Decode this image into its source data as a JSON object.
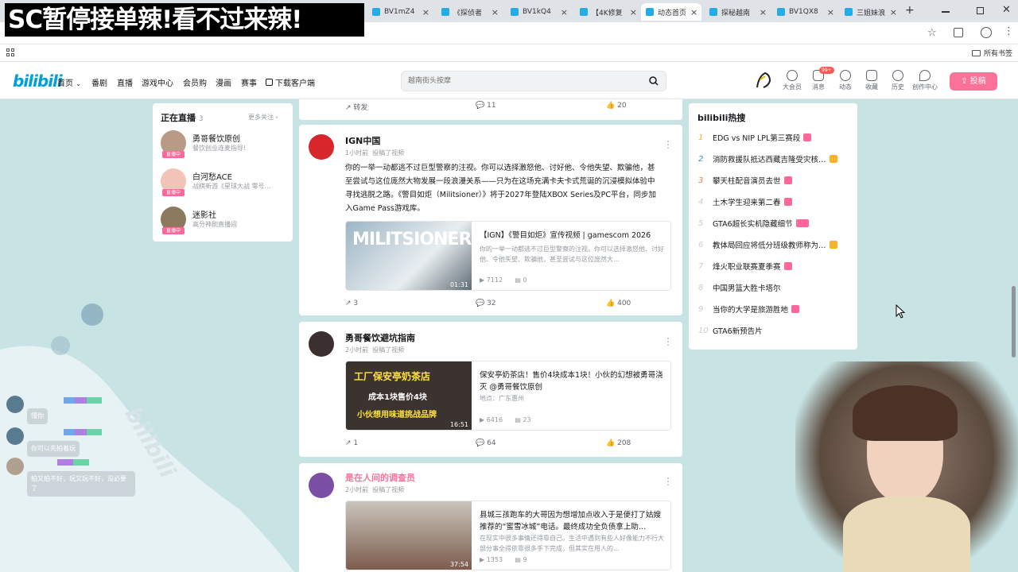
{
  "banner_text": "SC暂停接单辣!看不过来辣!",
  "browser": {
    "tabs": [
      {
        "label": "BV1mZ4",
        "color": "#23ade5"
      },
      {
        "label": "《探侦者",
        "color": "#23ade5"
      },
      {
        "label": "BV1kQ4",
        "color": "#23ade5"
      },
      {
        "label": "【4K修复",
        "color": "#23ade5"
      },
      {
        "label": "动态首页",
        "color": "#23ade5",
        "active": true
      },
      {
        "label": "探秘越南",
        "color": "#23ade5"
      },
      {
        "label": "BV1QX8",
        "color": "#23ade5"
      },
      {
        "label": "三姐妹浪",
        "color": "#23ade5"
      }
    ],
    "new_tab": "+",
    "close_tab": "×",
    "bookmarks_label": "所有书签"
  },
  "header": {
    "logo": "bilibili",
    "nav": [
      "首页",
      "番剧",
      "直播",
      "游戏中心",
      "会员购",
      "漫画",
      "赛事",
      "下载客户端"
    ],
    "search_placeholder": "越南街头按摩",
    "icons": [
      {
        "label": "大会员",
        "icon": "vip-icon"
      },
      {
        "label": "消息",
        "icon": "message-icon",
        "badge": "99+"
      },
      {
        "label": "动态",
        "icon": "dynamic-icon"
      },
      {
        "label": "收藏",
        "icon": "favorite-icon"
      },
      {
        "label": "历史",
        "icon": "history-icon"
      },
      {
        "label": "创作中心",
        "icon": "creator-icon"
      }
    ],
    "upload": "投稿"
  },
  "live": {
    "title": "正在直播",
    "count": "3",
    "more": "更多关注",
    "badge": "直播中",
    "items": [
      {
        "name": "勇哥餐饮原创",
        "desc": "餐饮创业连麦指导!"
      },
      {
        "name": "白河愁ACE",
        "desc": "战棋新游《星球大战 零号…"
      },
      {
        "name": "迷影社",
        "desc": "高分神剧直播间"
      }
    ]
  },
  "feed": {
    "top_actions": {
      "share": "转发",
      "comments": "11",
      "likes": "20"
    },
    "cards": [
      {
        "author": "IGN中国",
        "time": "1小时前",
        "action": "投稿了视频",
        "text": "你的一举一动都逃不过巨型警察的注视。你可以选择激怒他、讨好他、令他失望、欺骗他，甚至尝试与这位庞然大物发展一段浪漫关系——只为在这场充满卡夫卡式荒诞的沉浸模拟体验中寻找逃脱之路。《警目如炬（Militsioner）》将于2027年登陆XBOX Series及PC平台，同步加入Game Pass游戏库。",
        "video_title": "【IGN】《警目如炬》宣传视频 | gamescom 2026",
        "video_desc": "你的一举一动都逃不过巨型警察的注视。你可以选择激怒他、讨好他、令他失望、欺骗他，甚至尝试与这位庞然大…",
        "thumb_text": "MILITSIONER",
        "duration": "01:31",
        "plays": "7112",
        "danmaku": "0",
        "shares": "3",
        "comments": "32",
        "likes": "400"
      },
      {
        "author": "勇哥餐饮避坑指南",
        "time": "2小时前",
        "action": "投稿了视频",
        "video_title": "保安亭奶茶店！售价4块成本1块！小伙的幻想被勇哥浇灭 @勇哥餐饮原创",
        "video_desc": "地点：广东惠州",
        "thumb_lines": [
          "工厂保安亭奶茶店",
          "成本1块售价4块",
          "小伙想用味道挑战品牌"
        ],
        "duration": "16:51",
        "plays": "6416",
        "danmaku": "23",
        "shares": "1",
        "comments": "64",
        "likes": "208"
      },
      {
        "author": "是在人间的调查员",
        "time": "2小时前",
        "action": "投稿了视频",
        "video_title": "县城三孩跑车的大哥因为想增加点收入于是便打了姑嫂推荐的“蜜雪冰城”电话。最终成功全负债拿上助…",
        "video_desc": "在现实中很多事情还得靠自己。生活中遇到有些人好像能力不行大部分事全得依靠很多手下完成，但其实在用人的…",
        "duration": "37:54",
        "plays": "1353",
        "danmaku": "9"
      }
    ]
  },
  "hot": {
    "title": "bilibili热搜",
    "items": [
      {
        "rank": "1",
        "text": "EDG vs NIP LPL第三赛段",
        "tag": "live",
        "tag_color": "#ff6699"
      },
      {
        "rank": "2",
        "text": "消防救援队抵达西藏吉隆受灾核…",
        "tag": "hot",
        "tag_color": "#f9b32b"
      },
      {
        "rank": "3",
        "text": "攀天柱配音演员去世",
        "tag": "new",
        "tag_color": "#ff6699"
      },
      {
        "rank": "4",
        "text": "土木学生迎来第二春",
        "tag": "new",
        "tag_color": "#ff6699"
      },
      {
        "rank": "5",
        "text": "GTA6超长实机隐藏细节",
        "tag": "new",
        "tag_color": "#ff6699"
      },
      {
        "rank": "6",
        "text": "教体局回应将低分班级教师称为…",
        "tag": "hot",
        "tag_color": "#f9b32b"
      },
      {
        "rank": "7",
        "text": "烽火职业联赛夏季赛",
        "tag": "live",
        "tag_color": "#ff6699"
      },
      {
        "rank": "8",
        "text": "中国男篮大胜卡塔尔",
        "tag": "",
        "tag_color": ""
      },
      {
        "rank": "9",
        "text": "当你的大学是旅游胜地",
        "tag": "new",
        "tag_color": "#ff6699"
      },
      {
        "rank": "10",
        "text": "GTA6新预告片",
        "tag": "",
        "tag_color": ""
      }
    ]
  },
  "chat": [
    {
      "text": "懂你"
    },
    {
      "text": "你可以先拍着玩"
    },
    {
      "text": "拍又拍不好，玩又玩不好，没必要了"
    }
  ]
}
